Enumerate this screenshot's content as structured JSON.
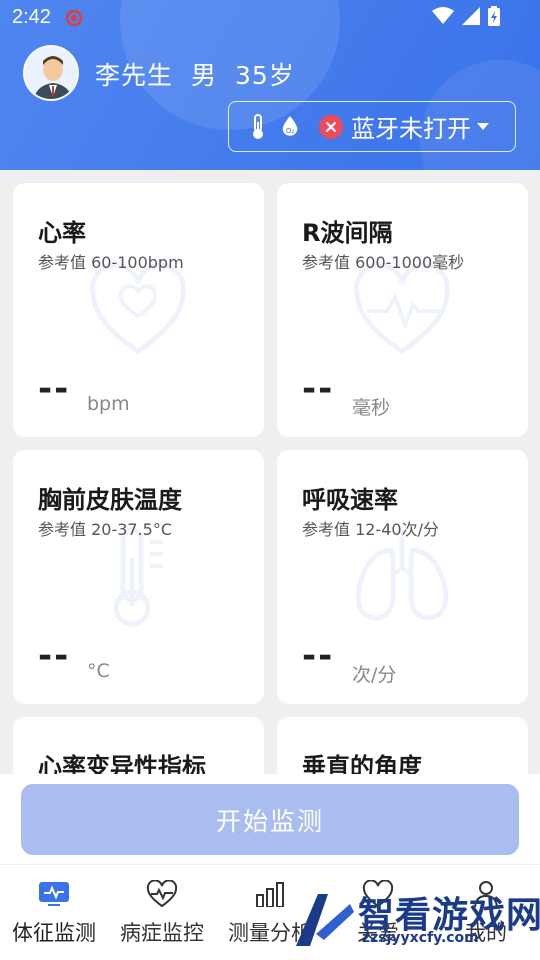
{
  "status_bar": {
    "time": "2:42"
  },
  "user": {
    "name": "李先生",
    "gender": "男",
    "age": "35岁"
  },
  "device": {
    "bluetooth_status": "蓝牙未打开"
  },
  "cards": [
    {
      "title": "心率",
      "reference": "参考值  60-100bpm",
      "value": "--",
      "unit": "bpm",
      "icon": "heart-icon"
    },
    {
      "title": "R波间隔",
      "reference": "参考值  600-1000毫秒",
      "value": "--",
      "unit": "毫秒",
      "icon": "heart-pulse-icon"
    },
    {
      "title": "胸前皮肤温度",
      "reference": "参考值  20-37.5°C",
      "value": "--",
      "unit": "°C",
      "icon": "thermometer-icon"
    },
    {
      "title": "呼吸速率",
      "reference": "参考值  12-40次/分",
      "value": "--",
      "unit": "次/分",
      "icon": "lungs-icon"
    },
    {
      "title": "心率变异性指标"
    },
    {
      "title": "垂直的角度"
    }
  ],
  "start_button": {
    "label": "开始监测"
  },
  "tabs": [
    {
      "label": "体征监测",
      "icon": "vitals-monitor-icon",
      "active": true
    },
    {
      "label": "病症监控",
      "icon": "heart-pulse-icon"
    },
    {
      "label": "测量分析",
      "icon": "bar-chart-icon"
    },
    {
      "label": "关爱",
      "icon": "heart-care-icon"
    },
    {
      "label": "我的",
      "icon": "person-icon"
    }
  ],
  "watermark": {
    "text": "智看游戏网",
    "url": "zzsjyyxcfy.com"
  },
  "colors": {
    "header_blue": "#4f86f0",
    "button_disabled": "#a9bdf0",
    "error_red": "#f04a5a",
    "icon_faint": "#eef3fb",
    "active_tab": "#3a72ea"
  }
}
